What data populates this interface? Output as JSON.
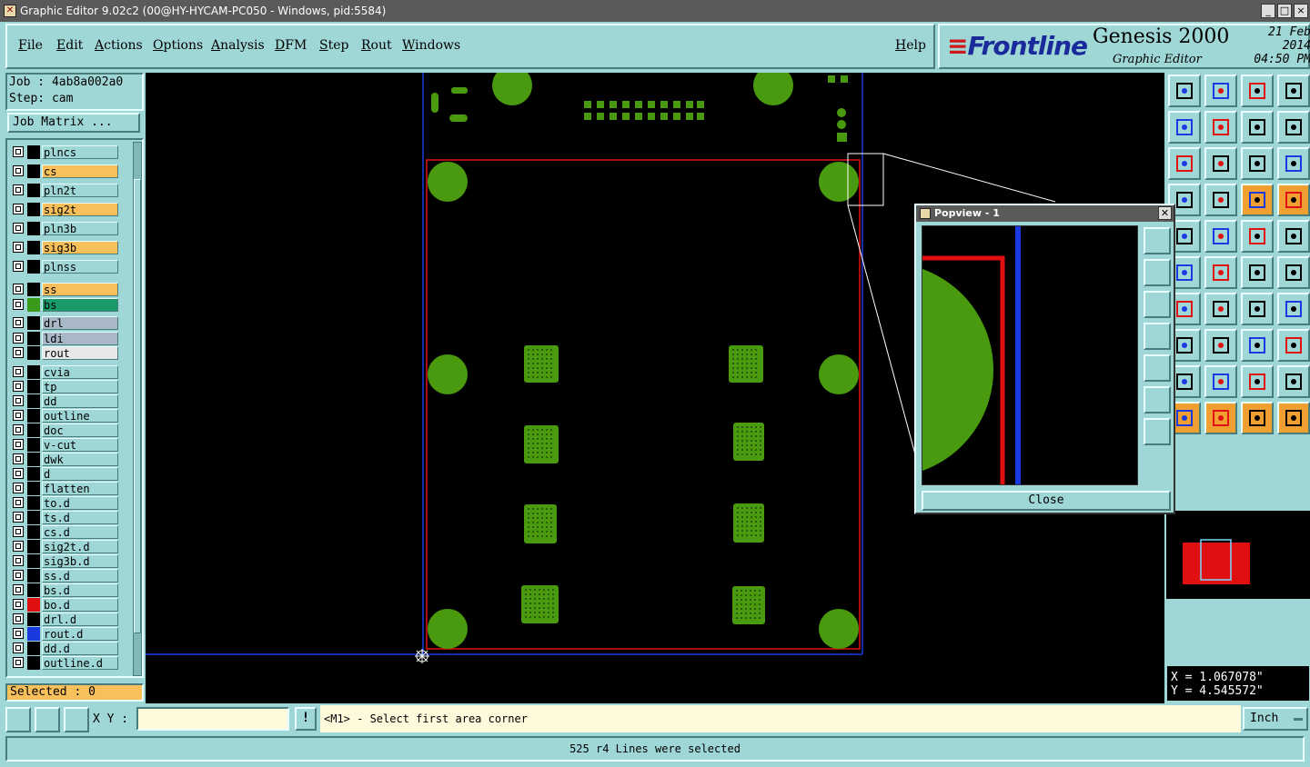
{
  "window": {
    "title": "Graphic Editor 9.02c2 (00@HY-HYCAM-PC050 - Windows, pid:5584)",
    "controls": [
      "_",
      "□",
      "×"
    ]
  },
  "menu": {
    "items": [
      "File",
      "Edit",
      "Actions",
      "Options",
      "Analysis",
      "DFM",
      "Step",
      "Rout",
      "Windows"
    ],
    "help": "Help"
  },
  "brand": {
    "logo": "Frontline",
    "product": "Genesis 2000",
    "subtitle": "Graphic Editor",
    "date": "21 Feb 2014",
    "time": "04:50 PM"
  },
  "job": {
    "job_line": "Job : 4ab8a002a0",
    "step_line": "Step: cam",
    "matrix_button": "Job Matrix ..."
  },
  "layers": [
    {
      "name": "plncs",
      "bg": "#9fd6d6",
      "swatch": "#000000"
    },
    {
      "name": "cs",
      "bg": "#f8c05a",
      "swatch": "#000000"
    },
    {
      "name": "pln2t",
      "bg": "#9fd6d6",
      "swatch": "#000000"
    },
    {
      "name": "sig2t",
      "bg": "#f8c05a",
      "swatch": "#000000"
    },
    {
      "name": "pln3b",
      "bg": "#9fd6d6",
      "swatch": "#000000"
    },
    {
      "name": "sig3b",
      "bg": "#f8c05a",
      "swatch": "#000000"
    },
    {
      "name": "plnss",
      "bg": "#9fd6d6",
      "swatch": "#000000"
    },
    {
      "name": "ss",
      "bg": "#f8c05a",
      "swatch": "#000000"
    },
    {
      "name": "bs",
      "bg": "#1a9a6a",
      "swatch": "#3a9a1a"
    },
    {
      "name": "drl",
      "bg": "#a8b8c8",
      "swatch": "#000000"
    },
    {
      "name": "ldi",
      "bg": "#a8b8c8",
      "swatch": "#000000"
    },
    {
      "name": "rout",
      "bg": "#e8e8e8",
      "swatch": "#000000"
    },
    {
      "name": "cvia",
      "bg": "#9fd6d6",
      "swatch": "#000000"
    },
    {
      "name": "tp",
      "bg": "#9fd6d6",
      "swatch": "#000000"
    },
    {
      "name": "dd",
      "bg": "#9fd6d6",
      "swatch": "#000000"
    },
    {
      "name": "outline",
      "bg": "#9fd6d6",
      "swatch": "#000000"
    },
    {
      "name": "doc",
      "bg": "#9fd6d6",
      "swatch": "#000000"
    },
    {
      "name": "v-cut",
      "bg": "#9fd6d6",
      "swatch": "#000000"
    },
    {
      "name": "dwk",
      "bg": "#9fd6d6",
      "swatch": "#000000"
    },
    {
      "name": "d",
      "bg": "#9fd6d6",
      "swatch": "#000000"
    },
    {
      "name": "flatten",
      "bg": "#9fd6d6",
      "swatch": "#000000"
    },
    {
      "name": "to.d",
      "bg": "#9fd6d6",
      "swatch": "#000000"
    },
    {
      "name": "ts.d",
      "bg": "#9fd6d6",
      "swatch": "#000000"
    },
    {
      "name": "cs.d",
      "bg": "#9fd6d6",
      "swatch": "#000000"
    },
    {
      "name": "sig2t.d",
      "bg": "#9fd6d6",
      "swatch": "#000000"
    },
    {
      "name": "sig3b.d",
      "bg": "#9fd6d6",
      "swatch": "#000000"
    },
    {
      "name": "ss.d",
      "bg": "#9fd6d6",
      "swatch": "#000000"
    },
    {
      "name": "bs.d",
      "bg": "#9fd6d6",
      "swatch": "#000000"
    },
    {
      "name": "bo.d",
      "bg": "#9fd6d6",
      "swatch": "#e01010"
    },
    {
      "name": "drl.d",
      "bg": "#9fd6d6",
      "swatch": "#000000"
    },
    {
      "name": "rout.d",
      "bg": "#9fd6d6",
      "swatch": "#1a3ae0"
    },
    {
      "name": "dd.d",
      "bg": "#9fd6d6",
      "swatch": "#000000"
    },
    {
      "name": "outline.d",
      "bg": "#9fd6d6",
      "swatch": "#000000"
    }
  ],
  "selected": "Selected : 0",
  "popview": {
    "title": "Popview - 1",
    "close_label": "Close"
  },
  "coords": {
    "x": "X = 1.067078\"",
    "y": "Y = 4.545572\""
  },
  "bottom": {
    "xy_label": "X Y :",
    "xy_value": "",
    "excl": "!",
    "prompt": "<M1> - Select first area corner",
    "unit": "Inch"
  },
  "status": "525 r4 Lines were selected",
  "colors": {
    "panel": "#9fd6d6",
    "feature_green": "#4a9a10",
    "profile_red": "#e01010",
    "profile_blue": "#1a3ae0",
    "prompt_bg": "#fffadc"
  }
}
